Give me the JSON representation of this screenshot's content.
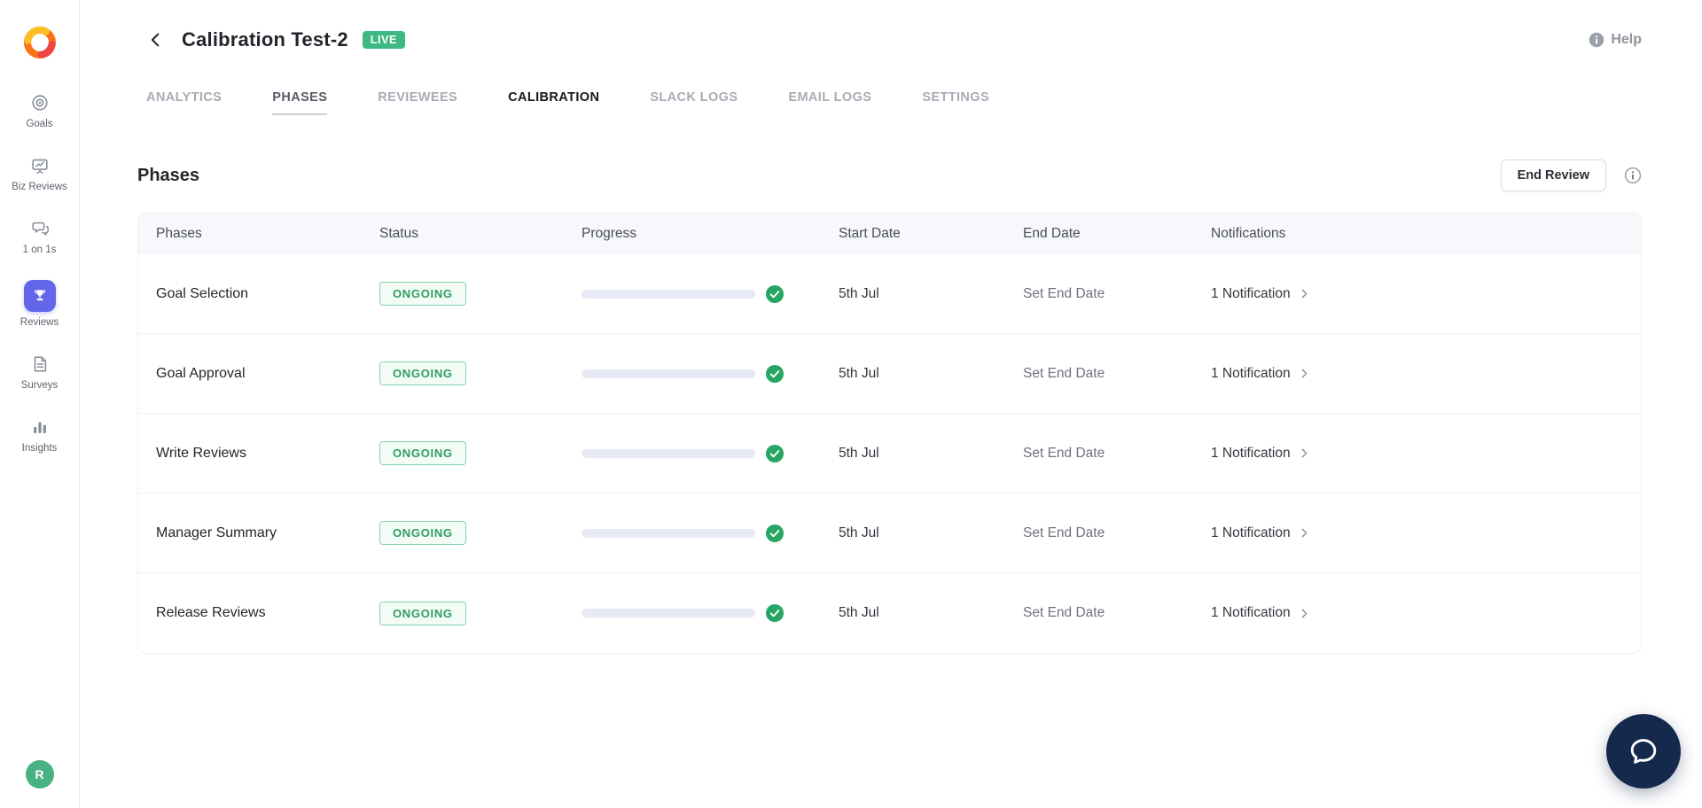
{
  "sidebar": {
    "items": [
      {
        "label": "Goals",
        "icon": "goals-icon",
        "active": false
      },
      {
        "label": "Biz Reviews",
        "icon": "biz-reviews-icon",
        "active": false
      },
      {
        "label": "1 on 1s",
        "icon": "one-on-ones-icon",
        "active": false
      },
      {
        "label": "Reviews",
        "icon": "reviews-icon",
        "active": true
      },
      {
        "label": "Surveys",
        "icon": "surveys-icon",
        "active": false
      },
      {
        "label": "Insights",
        "icon": "insights-icon",
        "active": false
      }
    ],
    "avatar_initial": "R"
  },
  "header": {
    "title": "Calibration Test-2",
    "live_badge": "LIVE",
    "help_label": "Help"
  },
  "tabs": [
    {
      "label": "ANALYTICS",
      "active": false
    },
    {
      "label": "PHASES",
      "active": true
    },
    {
      "label": "REVIEWEES",
      "active": false
    },
    {
      "label": "CALIBRATION",
      "active": false,
      "emphasis": true
    },
    {
      "label": "SLACK LOGS",
      "active": false
    },
    {
      "label": "EMAIL LOGS",
      "active": false
    },
    {
      "label": "SETTINGS",
      "active": false
    }
  ],
  "phases_section": {
    "heading": "Phases",
    "end_review_button": "End Review"
  },
  "table": {
    "columns": [
      "Phases",
      "Status",
      "Progress",
      "Start Date",
      "End Date",
      "Notifications"
    ],
    "rows": [
      {
        "phase": "Goal Selection",
        "status": "ONGOING",
        "progress_percent": 100,
        "start_date": "5th Jul",
        "end_date": "Set End Date",
        "notifications": "1 Notification"
      },
      {
        "phase": "Goal Approval",
        "status": "ONGOING",
        "progress_percent": 100,
        "start_date": "5th Jul",
        "end_date": "Set End Date",
        "notifications": "1 Notification"
      },
      {
        "phase": "Write Reviews",
        "status": "ONGOING",
        "progress_percent": 100,
        "start_date": "5th Jul",
        "end_date": "Set End Date",
        "notifications": "1 Notification"
      },
      {
        "phase": "Manager Summary",
        "status": "ONGOING",
        "progress_percent": 100,
        "start_date": "5th Jul",
        "end_date": "Set End Date",
        "notifications": "1 Notification"
      },
      {
        "phase": "Release Reviews",
        "status": "ONGOING",
        "progress_percent": 100,
        "start_date": "5th Jul",
        "end_date": "Set End Date",
        "notifications": "1 Notification"
      }
    ]
  },
  "colors": {
    "accent_indigo": "#6366e8",
    "progress_bar": "#7379e7",
    "check_green": "#27a563",
    "live_badge_green": "#3eb981",
    "ongoing_green": "#2f9e60",
    "fab_navy": "#15294d",
    "avatar_green": "#49b285",
    "logo_orange": "#f97316"
  }
}
